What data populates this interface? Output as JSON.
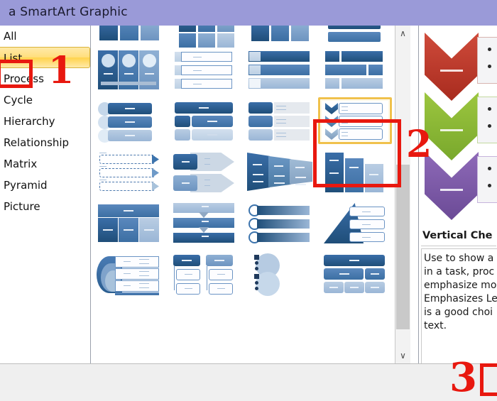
{
  "window": {
    "title": "a SmartArt Graphic"
  },
  "sidebar": {
    "items": [
      {
        "label": "All",
        "selected": false
      },
      {
        "label": "List",
        "selected": true
      },
      {
        "label": "Process",
        "selected": false
      },
      {
        "label": "Cycle",
        "selected": false
      },
      {
        "label": "Hierarchy",
        "selected": false
      },
      {
        "label": "Relationship",
        "selected": false
      },
      {
        "label": "Matrix",
        "selected": false
      },
      {
        "label": "Pyramid",
        "selected": false
      },
      {
        "label": "Picture",
        "selected": false
      }
    ]
  },
  "gallery": {
    "selected_index": 11,
    "rows": 6,
    "columns": 4,
    "layouts": [
      "basic-block-list",
      "alternating-hexagons",
      "picture-caption-list",
      "lined-list",
      "vertical-bullet-list",
      "vertical-box-list",
      "vertical-bracket-list",
      "square-accent-list",
      "picture-accent-list",
      "bending-picture-accent-list",
      "horizontal-picture-list",
      "vertical-chevron-list",
      "continuous-picture-list",
      "detailed-process",
      "grouped-list",
      "stacked-list",
      "table-list",
      "vertical-block-list",
      "horizontal-bullet-list",
      "pyramid-list",
      "target-list",
      "hierarchy-list",
      "vertical-circle-list",
      "table-hierarchy"
    ]
  },
  "scrollbar": {
    "up_arrow": "∧",
    "down_arrow": "∨"
  },
  "preview": {
    "title": "Vertical Che",
    "description": "Use to show a\nin a task, proc\nemphasize mo\nEmphasizes Le\nis a good choi\ntext.",
    "chevron_colors": [
      "#c0392b",
      "#8cb83a",
      "#7c5bad"
    ],
    "chevron_count": 3,
    "bullets_per_box": 2
  },
  "annotations": {
    "color": "#e8180f",
    "markers": [
      {
        "number": "1",
        "target": "sidebar-item-list"
      },
      {
        "number": "2",
        "target": "gallery-item-vertical-chevron-list"
      },
      {
        "number": "3",
        "target": "dialog-footer-ok-button"
      }
    ]
  },
  "colors": {
    "titlebar": "#9a9ad8",
    "selection_highlight": "#ffd34d",
    "accent_blue": "#1f4e79",
    "annotation_red": "#e8180f"
  }
}
